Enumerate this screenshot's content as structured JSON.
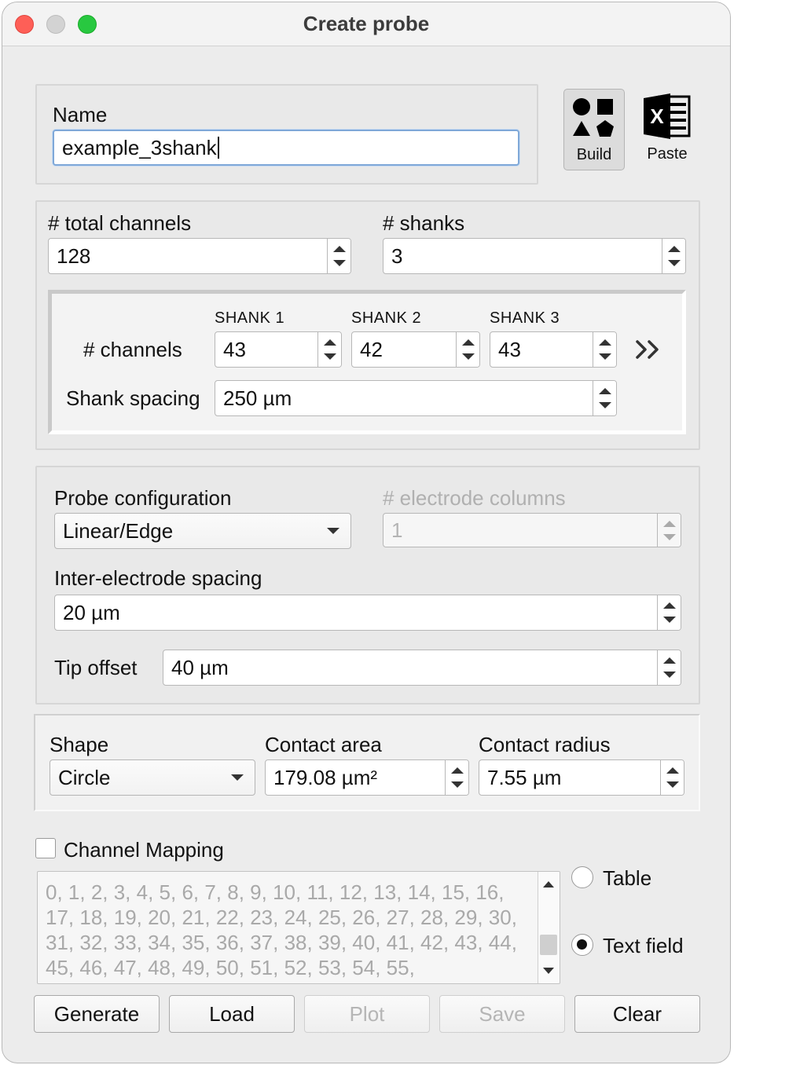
{
  "window": {
    "title": "Create probe"
  },
  "name_section": {
    "label": "Name",
    "value": "example_3shank"
  },
  "toolbar": {
    "build_label": "Build",
    "paste_label": "Paste"
  },
  "channels_section": {
    "total_label": "# total channels",
    "total_value": "128",
    "shanks_label": "# shanks",
    "shanks_value": "3",
    "shank_headers": [
      "SHANK 1",
      "SHANK 2",
      "SHANK 3"
    ],
    "channels_label": "# channels",
    "shank_channels": [
      "43",
      "42",
      "43"
    ],
    "spacing_label": "Shank spacing",
    "spacing_value": "250 µm"
  },
  "probe_section": {
    "config_label": "Probe configuration",
    "config_value": "Linear/Edge",
    "columns_label": "# electrode columns",
    "columns_value": "1",
    "inter_label": "Inter-electrode spacing",
    "inter_value": "20 µm",
    "tip_label": "Tip offset",
    "tip_value": "40 µm"
  },
  "contact_section": {
    "shape_label": "Shape",
    "shape_value": "Circle",
    "area_label": "Contact area",
    "area_value": "179.08 µm²",
    "radius_label": "Contact radius",
    "radius_value": "7.55 µm"
  },
  "mapping_section": {
    "checkbox_label": "Channel Mapping",
    "text": "0, 1, 2, 3, 4, 5, 6, 7, 8, 9, 10, 11, 12, 13, 14, 15, 16, 17, 18, 19, 20, 21, 22, 23, 24, 25, 26, 27, 28, 29, 30, 31, 32, 33, 34, 35, 36, 37, 38, 39, 40, 41, 42, 43, 44, 45, 46, 47, 48, 49, 50, 51, 52, 53, 54, 55,",
    "radio_table": "Table",
    "radio_text": "Text field"
  },
  "buttons": {
    "generate": "Generate",
    "load": "Load",
    "plot": "Plot",
    "save": "Save",
    "clear": "Clear"
  },
  "colors": {
    "close": "#fe5f57",
    "minimize": "#d3d3d3",
    "maximize": "#28c840",
    "focus_ring": "#7fa8d8"
  }
}
